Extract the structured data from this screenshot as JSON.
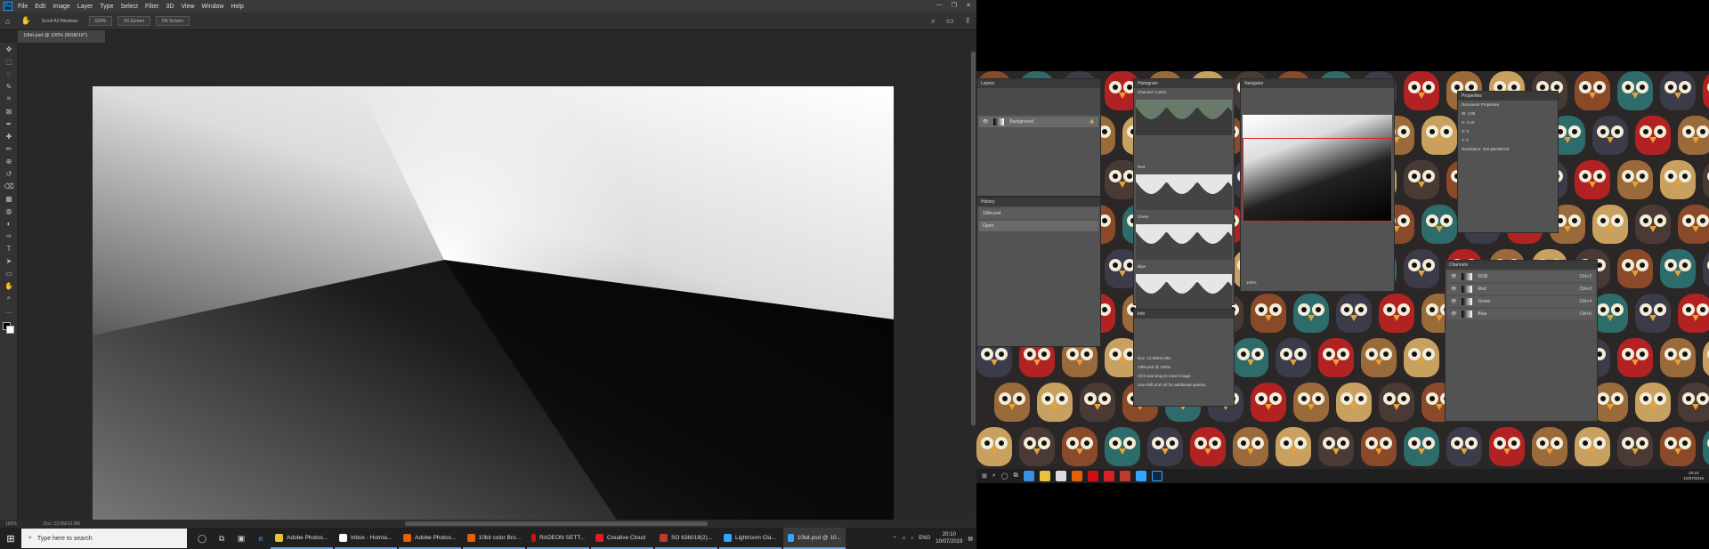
{
  "photoshop": {
    "logo": "Ps",
    "menu": [
      "File",
      "Edit",
      "Image",
      "Layer",
      "Type",
      "Select",
      "Filter",
      "3D",
      "View",
      "Window",
      "Help"
    ],
    "options": {
      "scroll_all": "Scroll All Windows",
      "zoom": "100%",
      "fit_screen": "Fit Screen",
      "fill_screen": "Fill Screen"
    },
    "document_tab": "10bit.psd @ 100% (RGB/16*)",
    "tools": [
      "move-icon",
      "marquee-icon",
      "lasso-icon",
      "quick-select-icon",
      "crop-icon",
      "frame-icon",
      "eyedropper-icon",
      "healing-icon",
      "brush-icon",
      "stamp-icon",
      "history-brush-icon",
      "eraser-icon",
      "gradient-icon",
      "blur-icon",
      "dodge-icon",
      "pen-icon",
      "type-icon",
      "path-select-icon",
      "rectangle-icon",
      "hand-icon",
      "zoom-icon",
      "more-icon"
    ],
    "status": {
      "zoom": "100%",
      "doc": "Doc: 12.0M/12.0M"
    }
  },
  "taskbar": {
    "search_placeholder": "Type here to search",
    "apps": [
      {
        "label": "Adobe Photos...",
        "color": "#e8c33a"
      },
      {
        "label": "Inbox - Hotma...",
        "color": "#ffffff"
      },
      {
        "label": "Adobe Photos...",
        "color": "#e66000"
      },
      {
        "label": "10bit color Bro...",
        "color": "#e66000"
      },
      {
        "label": "RADEON SETT...",
        "color": "#d01010"
      },
      {
        "label": "Creative Cloud",
        "color": "#da1f26"
      },
      {
        "label": "SO 636018(2)...",
        "color": "#c0392b"
      },
      {
        "label": "Lightroom Cla...",
        "color": "#31a8ff"
      },
      {
        "label": "10bit.psd @ 10...",
        "color": "#31a8ff"
      }
    ],
    "tray": {
      "lang": "ENG",
      "time": "20:10",
      "date": "10/07/2019"
    }
  },
  "panels": {
    "layers": {
      "title": "Layers",
      "layer_name": "Background"
    },
    "histogram": {
      "title": "Histogram",
      "channel_label": "Channel:",
      "channel": "Colors",
      "labels": [
        "Red",
        "Green",
        "Blue"
      ]
    },
    "navigator": {
      "title": "Navigator",
      "zoom": "100%"
    },
    "properties": {
      "title": "Properties",
      "doc_props": "Document Properties",
      "W": "W: 4.95",
      "H": "H: 3.16",
      "X": "X: 0",
      "Y": "Y: 0",
      "res": "Resolution: 300 pixels/inch"
    },
    "history": {
      "title": "History",
      "items": [
        "10bit.psd",
        "Open"
      ]
    },
    "info": {
      "title": "Info",
      "lines": [
        "Doc: 12.0M/12.0M",
        "10bit.psd @ 100%",
        "Click and drag to move image",
        "Use shift and ctrl for additional options."
      ]
    },
    "channels": {
      "title": "Channels",
      "items": [
        {
          "name": "RGB",
          "key": "Ctrl+2"
        },
        {
          "name": "Red",
          "key": "Ctrl+3"
        },
        {
          "name": "Green",
          "key": "Ctrl+4"
        },
        {
          "name": "Blue",
          "key": "Ctrl+5"
        }
      ]
    }
  },
  "taskbar2": {
    "time": "20:10",
    "date": "10/07/2019"
  }
}
